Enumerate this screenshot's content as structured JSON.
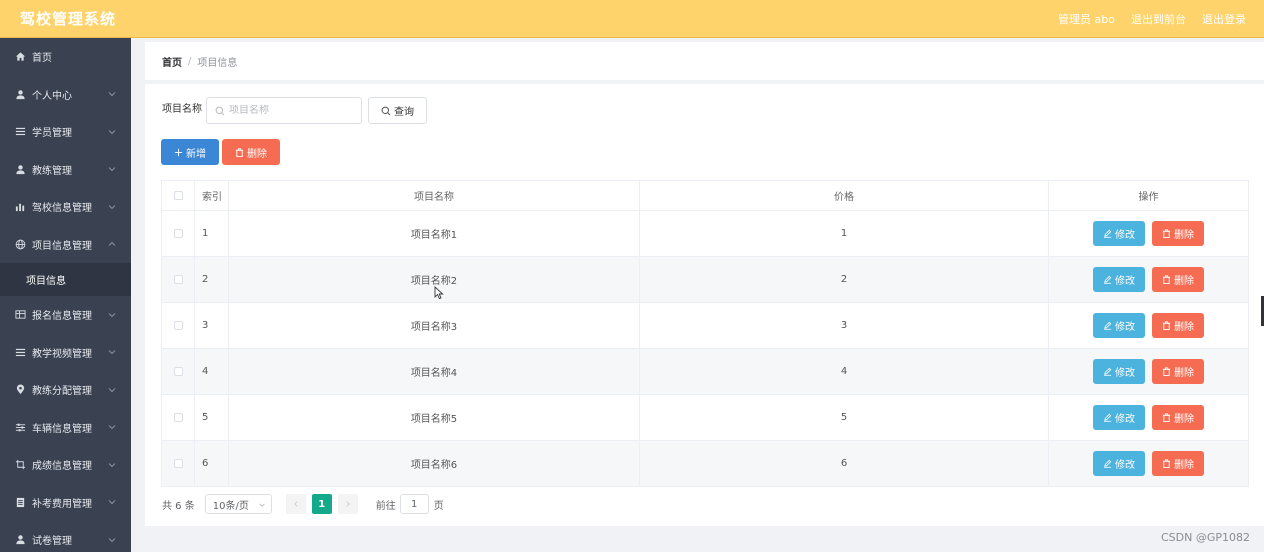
{
  "header": {
    "title": "驾校管理系统",
    "admin": "管理员 abo",
    "to_front": "退出到前台",
    "logout": "退出登录"
  },
  "sidebar": {
    "items": [
      {
        "label": "首页",
        "icon": "home-icon",
        "chevron": false
      },
      {
        "label": "个人中心",
        "icon": "user-icon",
        "chevron": true
      },
      {
        "label": "学员管理",
        "icon": "list-icon",
        "chevron": true
      },
      {
        "label": "教练管理",
        "icon": "user-icon",
        "chevron": true
      },
      {
        "label": "驾校信息管理",
        "icon": "chart-icon",
        "chevron": true
      },
      {
        "label": "项目信息管理",
        "icon": "globe-icon",
        "chevron": true,
        "expanded": true
      },
      {
        "label": "报名信息管理",
        "icon": "table-icon",
        "chevron": true
      },
      {
        "label": "教学视频管理",
        "icon": "list-icon",
        "chevron": true
      },
      {
        "label": "教练分配管理",
        "icon": "location-icon",
        "chevron": true
      },
      {
        "label": "车辆信息管理",
        "icon": "sliders-icon",
        "chevron": true
      },
      {
        "label": "成绩信息管理",
        "icon": "crop-icon",
        "chevron": true
      },
      {
        "label": "补考费用管理",
        "icon": "document-icon",
        "chevron": true
      },
      {
        "label": "试卷管理",
        "icon": "user-icon",
        "chevron": true
      }
    ],
    "active_sub": "项目信息"
  },
  "breadcrumb": {
    "home": "首页",
    "separator": "/",
    "current": "项目信息"
  },
  "search": {
    "label": "项目名称",
    "placeholder": "项目名称",
    "value": "",
    "query_label": "查询"
  },
  "toolbar": {
    "add_label": "新增",
    "delete_label": "删除"
  },
  "table": {
    "columns": [
      "",
      "索引",
      "项目名称",
      "价格",
      "操作"
    ],
    "rows": [
      {
        "index": "1",
        "name": "项目名称1",
        "price": "1"
      },
      {
        "index": "2",
        "name": "项目名称2",
        "price": "2"
      },
      {
        "index": "3",
        "name": "项目名称3",
        "price": "3"
      },
      {
        "index": "4",
        "name": "项目名称4",
        "price": "4"
      },
      {
        "index": "5",
        "name": "项目名称5",
        "price": "5"
      },
      {
        "index": "6",
        "name": "项目名称6",
        "price": "6"
      }
    ],
    "edit_label": "修改",
    "delete_label": "删除"
  },
  "pagination": {
    "total_text": "共 6 条",
    "page_size": "10条/页",
    "current_page": "1",
    "goto_label": "前往",
    "goto_value": "1",
    "page_unit": "页"
  },
  "watermark": "CSDN @GP1082",
  "colors": {
    "header_bg": "#ffd36b",
    "sidebar_bg": "#3a4150",
    "primary": "#3b87d6",
    "danger": "#f56c52",
    "info": "#4cb3de",
    "page_active": "#13a98a"
  }
}
